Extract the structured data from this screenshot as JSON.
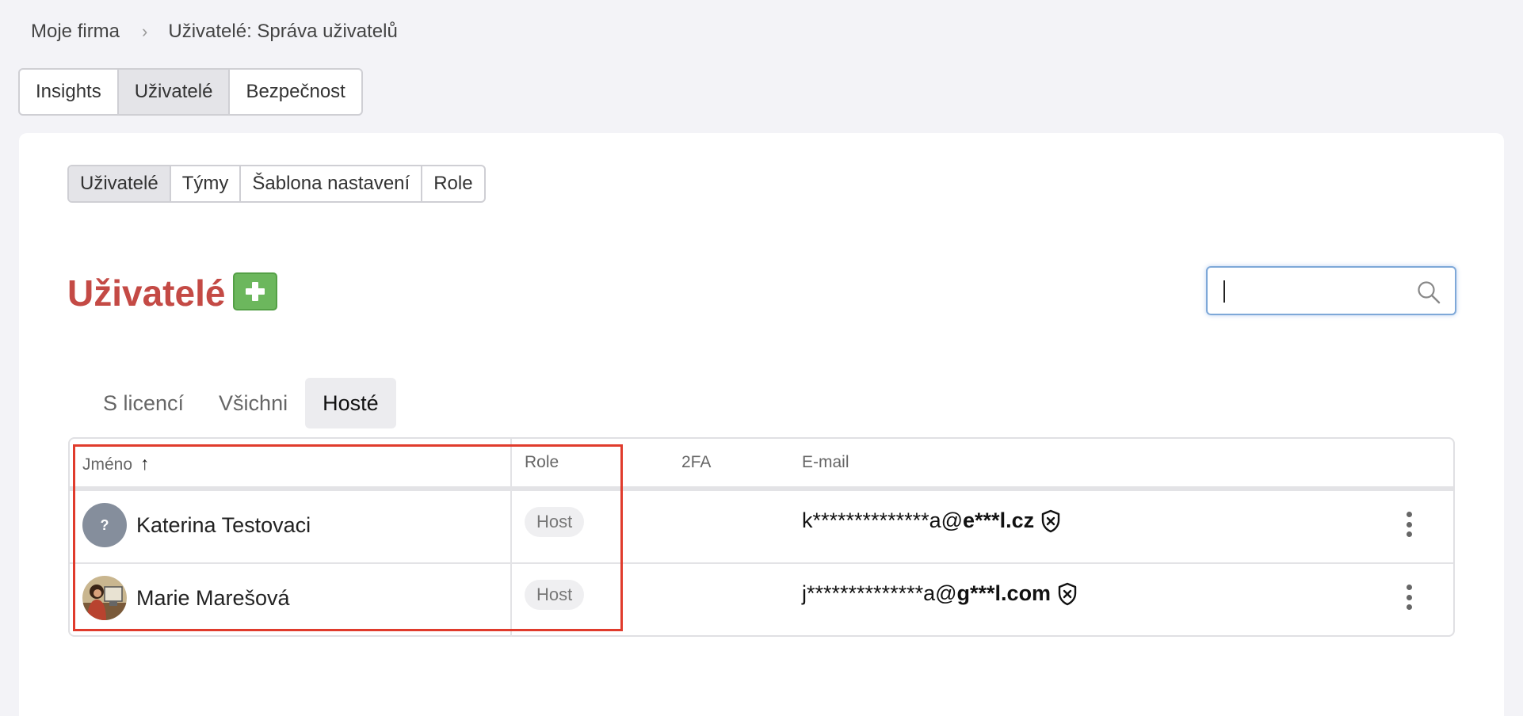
{
  "breadcrumb": {
    "root": "Moje firma",
    "current": "Uživatelé: Správa uživatelů"
  },
  "top_tabs": [
    "Insights",
    "Uživatelé",
    "Bezpečnost"
  ],
  "top_tabs_active": "Uživatelé",
  "sub_tabs": [
    "Uživatelé",
    "Týmy",
    "Šablona nastavení",
    "Role"
  ],
  "sub_tabs_active": "Uživatelé",
  "page_title": "Uživatelé",
  "search": {
    "value": "",
    "placeholder": ""
  },
  "filter_tabs": [
    "S licencí",
    "Všichni",
    "Hosté"
  ],
  "filter_tabs_active": "Hosté",
  "table": {
    "columns": {
      "name": "Jméno",
      "sort": "↑",
      "role": "Role",
      "twofa": "2FA",
      "email": "E-mail"
    },
    "rows": [
      {
        "avatar": "?",
        "name": "Katerina Testovaci",
        "role": "Host",
        "email_local": "k**************a@",
        "email_domain": "e***l.cz"
      },
      {
        "avatar": "photo",
        "name": "Marie Marešová",
        "role": "Host",
        "email_local": "j**************a@",
        "email_domain": "g***l.com"
      }
    ]
  },
  "colors": {
    "title": "#c44a45",
    "add_button": "#6cb75d",
    "highlight": "#e03b2c",
    "focus": "#7ea8d8"
  }
}
